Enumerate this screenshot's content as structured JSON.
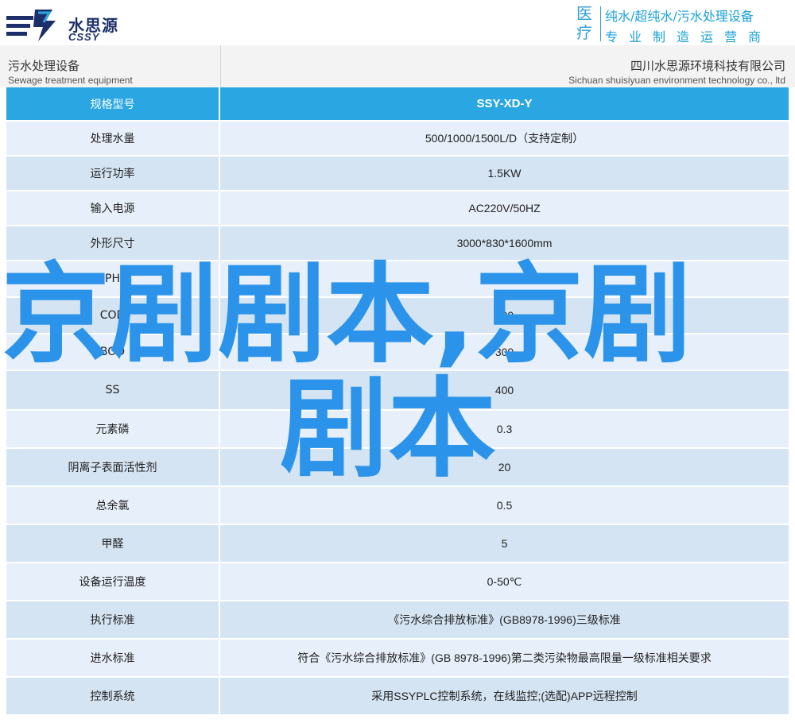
{
  "header": {
    "logo_cn": "水思源",
    "logo_en": "CSSY",
    "medical_label": "医疗",
    "tagline_1": "纯水/超纯水/污水处理设备",
    "tagline_2": "专业制造运营商",
    "category_cn": "污水处理设备",
    "category_en": "Sewage treatment equipment",
    "company_cn": "四川水思源环境科技有限公司",
    "company_en": "Sichuan shuisiyuan environment technology co., ltd"
  },
  "colors": {
    "accent": "#2aa7e2",
    "brand_navy": "#1d2f6b",
    "row_light": "#e7f0fa",
    "row_dark": "#d4e4f3",
    "overlay_text": "#2b93e9"
  },
  "table": {
    "header": {
      "label": "规格型号",
      "value": "SSY-XD-Y"
    },
    "rows": [
      {
        "label": "处理水量",
        "value": "500/1000/1500L/D（支持定制）"
      },
      {
        "label": "运行功率",
        "value": "1.5KW"
      },
      {
        "label": "输入电源",
        "value": "AC220V/50HZ"
      },
      {
        "label": "外形尺寸",
        "value": "3000*830*1600mm"
      },
      {
        "label": "PH",
        "value": "6~9"
      },
      {
        "label": "COD",
        "value": "500"
      },
      {
        "label": "BOD",
        "value": "300"
      },
      {
        "label": "SS",
        "value": "400"
      },
      {
        "label": "元素磷",
        "value": "0.3"
      },
      {
        "label": "阴离子表面活性剂",
        "value": "20"
      },
      {
        "label": "总余氯",
        "value": "0.5"
      },
      {
        "label": "甲醛",
        "value": "5"
      },
      {
        "label": "设备运行温度",
        "value": "0-50℃"
      },
      {
        "label": "执行标准",
        "value": "《污水综合排放标准》(GB8978-1996)三级标准"
      },
      {
        "label": "进水标准",
        "value": "符合《污水综合排放标准》(GB 8978-1996)第二类污染物最高限量一级标准相关要求"
      },
      {
        "label": "控制系统",
        "value": "采用SSYPLC控制系统，在线监控;(选配)APP远程控制"
      }
    ]
  },
  "overlay": {
    "line1": "京剧剧本,京剧",
    "line2": "剧本"
  }
}
